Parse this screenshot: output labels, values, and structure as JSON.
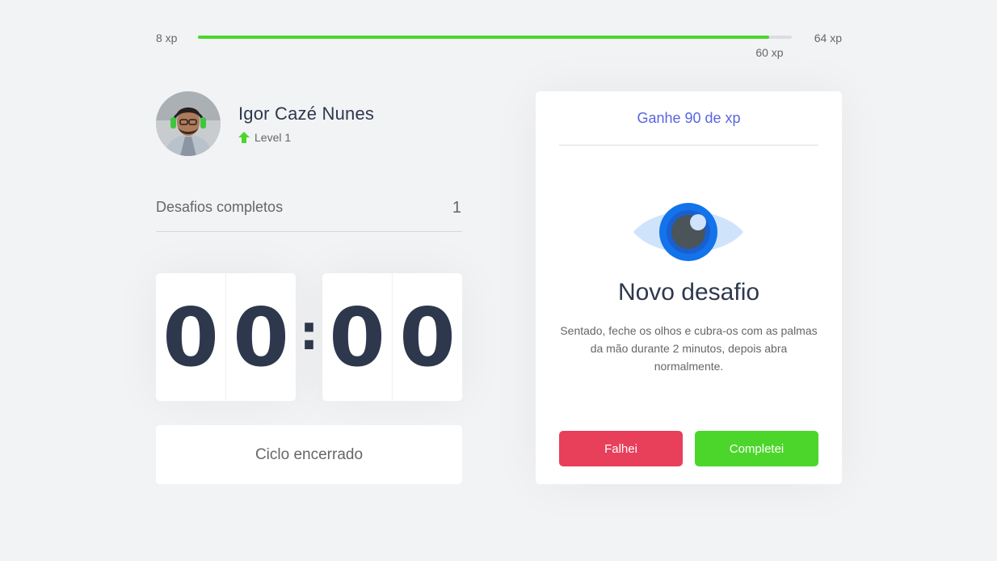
{
  "xp": {
    "min_label": "8 xp",
    "max_label": "64 xp",
    "current_label": "60 xp",
    "progress": 0.9625
  },
  "profile": {
    "name": "Igor Cazé Nunes",
    "level": "Level 1",
    "level_icon": "arrow-up-icon"
  },
  "stats": {
    "completed_label": "Desafios completos",
    "completed_count": "1"
  },
  "countdown": {
    "minutes": [
      "0",
      "0"
    ],
    "separator": ":",
    "seconds": [
      "0",
      "0"
    ]
  },
  "cycle_button": {
    "label": "Ciclo encerrado"
  },
  "challenge": {
    "header": "Ganhe 90 de xp",
    "icon": "eye-icon",
    "title": "Novo desafio",
    "description": "Sentado, feche os olhos e cubra-os com as palmas da mão durante 2 minutos, depois abra normalmente.",
    "failed_label": "Falhei",
    "success_label": "Completei"
  },
  "colors": {
    "background": "#f2f3f5",
    "green": "#4cd62b",
    "red": "#e83f5b",
    "blue": "#5965e0",
    "title": "#2e384d",
    "text": "#666666"
  }
}
